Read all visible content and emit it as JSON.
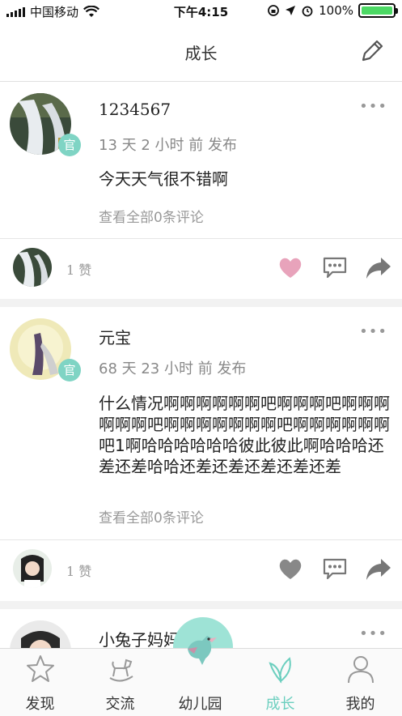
{
  "status_bar": {
    "carrier": "中国移动",
    "time": "下午4:15",
    "battery": "100%"
  },
  "nav": {
    "title": "成长"
  },
  "posts": [
    {
      "username": "1234567",
      "meta": "13 天 2 小时 前 发布",
      "badge": "官",
      "content": "今天天气很不错啊",
      "comments_link": "查看全部0条评论",
      "likes": "1 赞",
      "liked": true
    },
    {
      "username": "元宝",
      "meta": "68 天 23 小时 前 发布",
      "badge": "官",
      "content": "什么情况啊啊啊啊啊啊吧啊啊啊吧啊啊啊 啊啊啊吧啊啊啊啊啊啊啊吧啊啊啊啊啊啊吧1啊哈哈哈哈哈哈彼此彼此啊哈哈哈还差还差哈哈还差还差还差还差还差",
      "comments_link": "查看全部0条评论",
      "likes": "1 赞",
      "liked": false
    },
    {
      "username": "小兔子妈妈"
    }
  ],
  "more_glyph": "•••",
  "tabs": [
    {
      "label": "发现",
      "icon": "star-icon"
    },
    {
      "label": "交流",
      "icon": "rocking-horse-icon"
    },
    {
      "label": "幼儿园",
      "icon": "bird-icon"
    },
    {
      "label": "成长",
      "icon": "leaf-icon"
    },
    {
      "label": "我的",
      "icon": "person-icon"
    }
  ],
  "colors": {
    "accent": "#6ccfbf",
    "heart_liked": "#e8a3bb",
    "heart_default": "#888888",
    "badge": "#7fd4c4"
  }
}
